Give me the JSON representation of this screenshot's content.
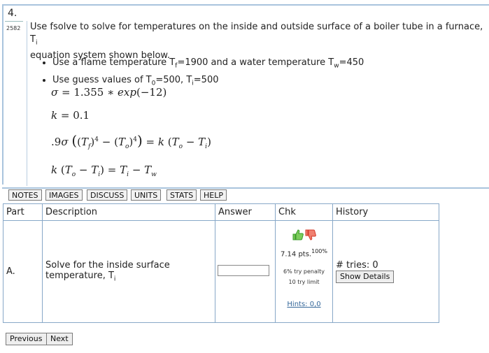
{
  "question": {
    "number": "4.",
    "id": "2582",
    "text_main": "Use fsolve to solve for temperatures on the inside and outside surface of a boiler tube in a furnace, T",
    "text_sub": "i",
    "text_tail": "equation system shown below.",
    "bullets": [
      {
        "a": "Use a flame temperature T",
        "s1": "f",
        "b": "=1900 and a water temperature T",
        "s2": "w",
        "c": "=450"
      },
      {
        "a": "Use guess values of T",
        "s1": "0",
        "b": "=500, T",
        "s2": "i",
        "c": "=500"
      }
    ],
    "equations": {
      "sigma": "σ = 1.355 ∗ exp(−12)",
      "k": "k = 0.1",
      "eq3": ".9σ ((T_f)^4 − (T_o)^4) = k (T_o − T_i)",
      "eq4": "k (T_o − T_i) = T_i − T_w"
    }
  },
  "tabs": [
    "NOTES",
    "IMAGES",
    "DISCUSS",
    "UNITS",
    "STATS",
    "HELP"
  ],
  "table": {
    "headers": {
      "part": "Part",
      "description": "Description",
      "answer": "Answer",
      "chk": "Chk",
      "history": "History"
    },
    "row": {
      "part": "A.",
      "desc_line1": "Solve for the inside surface",
      "desc_line2": "temperature, T",
      "desc_sub": "i",
      "answer_value": "",
      "points": "7.14 pts.",
      "percent": "100%",
      "penalty": "6% try penalty",
      "limit": "10 try limit",
      "hints": "Hints: 0,0",
      "tries_label": "# tries: 0",
      "show_details": "Show Details"
    }
  },
  "nav": {
    "previous": "Previous",
    "next": "Next"
  },
  "colors": {
    "thumbs_up": "#3a9a2a",
    "thumbs_down": "#d33a2a",
    "border": "#88a8c8"
  }
}
